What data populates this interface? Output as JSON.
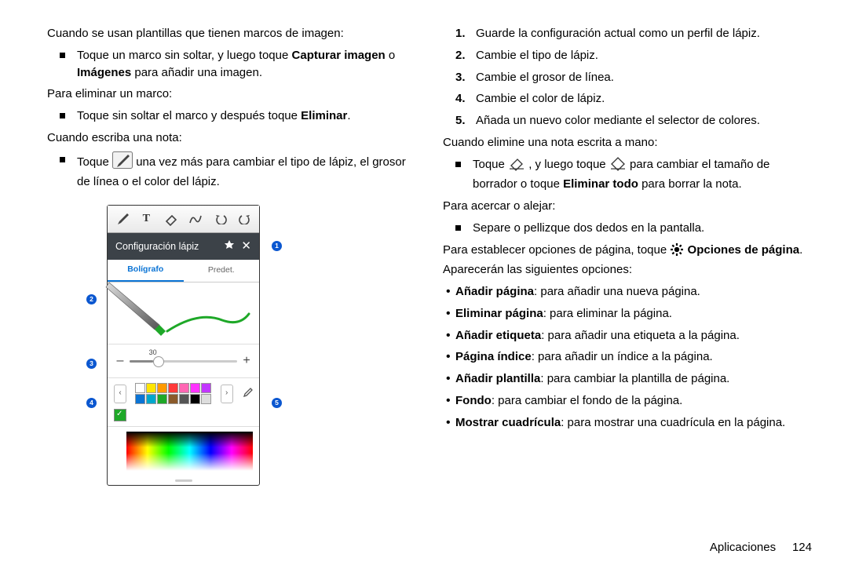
{
  "left": {
    "intro_templates": "Cuando se usan plantillas que tienen marcos de imagen:",
    "templates_item_pre": "Toque un marco sin soltar, y luego toque ",
    "templates_bold1": "Capturar imagen",
    "templates_mid": " o ",
    "templates_bold2": "Imágenes",
    "templates_post": " para añadir una imagen.",
    "remove_frame_intro": "Para eliminar un marco:",
    "remove_frame_item_pre": "Toque sin soltar el marco y después toque ",
    "remove_frame_bold": "Eliminar",
    "remove_frame_post": ".",
    "write_note_intro": "Cuando escriba una nota:",
    "write_note_pre": "Toque ",
    "write_note_post": " una vez más para cambiar el tipo de lápiz, el grosor de línea o el color del lápiz."
  },
  "right": {
    "steps": [
      "Guarde la configuración actual como un perfil de lápiz.",
      "Cambie el tipo de lápiz.",
      "Cambie el grosor de línea.",
      "Cambie el color de lápiz.",
      "Añada un nuevo color mediante el selector de colores."
    ],
    "delete_intro": "Cuando elimine una nota escrita a mano:",
    "delete_pre": "Toque ",
    "delete_mid": ", y luego toque ",
    "delete_post1": " para cambiar el tamaño de borrador o toque ",
    "delete_bold": "Eliminar todo",
    "delete_post2": " para borrar la nota.",
    "zoom_intro": "Para acercar o alejar:",
    "zoom_item": "Separe o pellizque dos dedos en la pantalla.",
    "options_pre": "Para establecer opciones de página, toque ",
    "options_bold1": "Opciones de página",
    "options_post": ". Aparecerán las siguientes opciones:",
    "opts": [
      {
        "name": "Añadir página",
        "rest": ": para añadir una nueva página."
      },
      {
        "name": "Eliminar página",
        "rest": ": para eliminar la página."
      },
      {
        "name": "Añadir etiqueta",
        "rest": ": para añadir una etiqueta a la página."
      },
      {
        "name": "Página índice",
        "rest": ": para añadir un índice a la página."
      },
      {
        "name": "Añadir plantilla",
        "rest": ": para cambiar la plantilla de página."
      },
      {
        "name": "Fondo",
        "rest": ": para cambiar el fondo de la página."
      },
      {
        "name": "Mostrar cuadrícula",
        "rest": ": para mostrar una cuadrícula en la página."
      }
    ]
  },
  "figure": {
    "header": "Configuración lápiz",
    "tab_active": "Bolígrafo",
    "tab_inactive": "Predet.",
    "slider_value": "30",
    "swatch_rows": [
      [
        "#ffffff",
        "#ffe500",
        "#ff9a00",
        "#ff3a3a",
        "#ff66b3",
        "#ff33ff",
        "#c236ff"
      ],
      [
        "#0b74d5",
        "#00a7cc",
        "#1ea828",
        "#8a5a2b",
        "#555555",
        "#000000",
        "#dddddd"
      ]
    ]
  },
  "footer": {
    "section": "Aplicaciones",
    "page": "124"
  }
}
